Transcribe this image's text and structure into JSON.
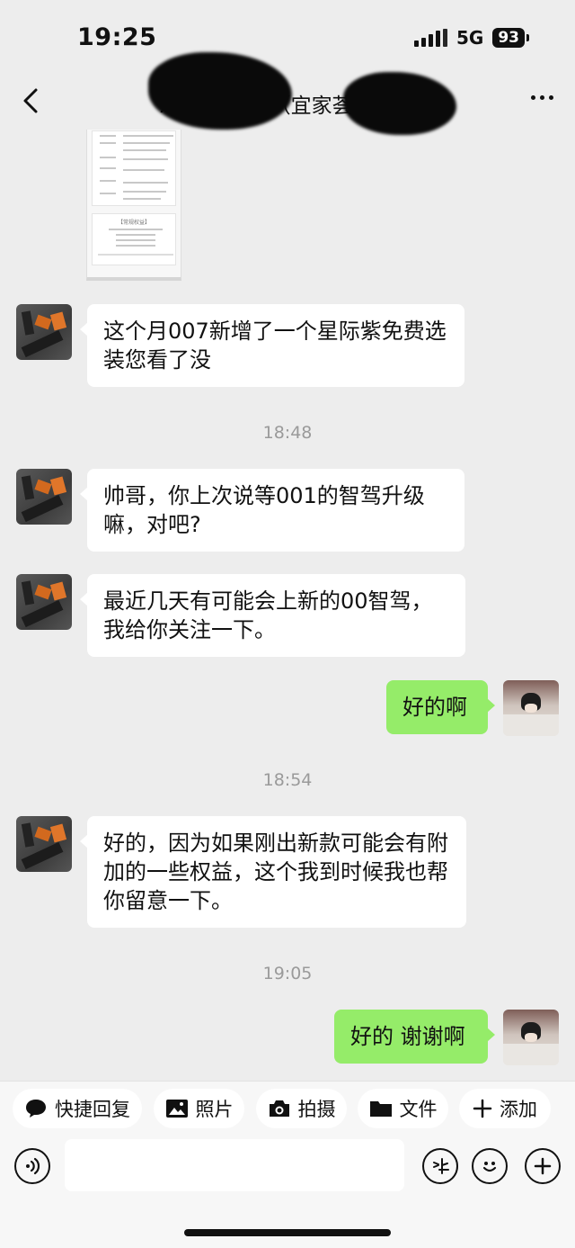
{
  "status_bar": {
    "time": "19:25",
    "network": "5G",
    "battery": "93"
  },
  "nav": {
    "title": "A  吕 闫云飞（宜家荟聚店）",
    "back_icon": "chevron-left-icon",
    "more_icon": "more-horizontal-icon"
  },
  "doc_card": {
    "section_title": "【常规权益】"
  },
  "messages": [
    {
      "side": "in",
      "text": "这个月007新增了一个星际紫免费选装您看了没"
    },
    {
      "type": "time",
      "text": "18:48"
    },
    {
      "side": "in",
      "text": "帅哥，你上次说等001的智驾升级嘛，对吧?"
    },
    {
      "side": "in",
      "text": "最近几天有可能会上新的00智驾，我给你关注一下。"
    },
    {
      "side": "out",
      "text": "好的啊"
    },
    {
      "type": "time",
      "text": "18:54"
    },
    {
      "side": "in",
      "text": "好的，因为如果刚出新款可能会有附加的一些权益，这个我到时候我也帮你留意一下。"
    },
    {
      "type": "time",
      "text": "19:05"
    },
    {
      "side": "out",
      "text": "好的 谢谢啊"
    }
  ],
  "quick_actions": [
    {
      "label": "快捷回复",
      "icon": "chat-bubble-icon"
    },
    {
      "label": "照片",
      "icon": "image-icon"
    },
    {
      "label": "拍摄",
      "icon": "camera-icon"
    },
    {
      "label": "文件",
      "icon": "folder-icon"
    },
    {
      "label": "添加",
      "icon": "plus-icon"
    }
  ],
  "input": {
    "placeholder": ""
  },
  "colors": {
    "background": "#ededed",
    "outgoing_bubble": "#95ec69",
    "incoming_bubble": "#ffffff",
    "timestamp": "#9a9a9a"
  }
}
